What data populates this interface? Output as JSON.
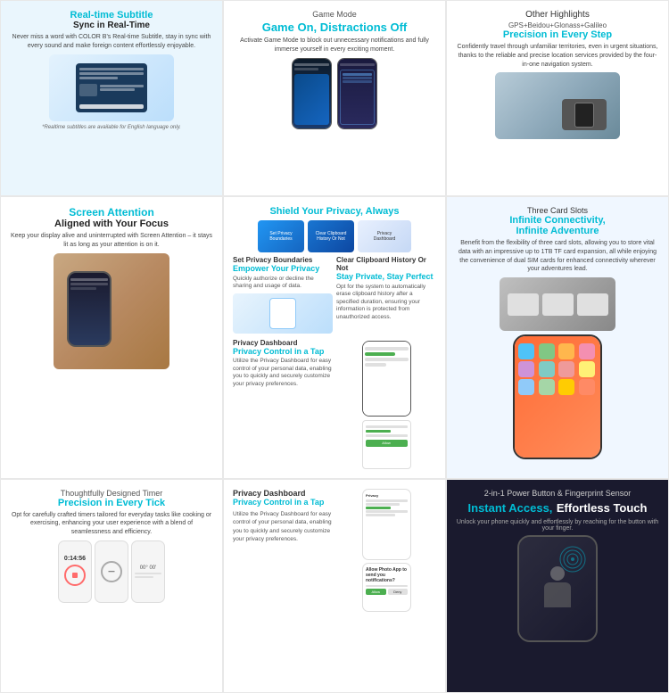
{
  "sections": {
    "cell1": {
      "label": "Real-time Subtitle",
      "subtitle": "Sync in Real-Time",
      "body": "Never miss a word with COLOR B's Real-time Subtitle, stay in sync with every sound and make foreign content effortlessly enjoyable.",
      "note": "*Realtime subtitles are available for English language only."
    },
    "cell2": {
      "label": "Game Mode",
      "title": "Game On, Distractions Off",
      "body": "Activate Game Mode to block out unnecessary notifications and fully immerse yourself in every exciting moment."
    },
    "cell3": {
      "label": "Other Highlights",
      "gps_label": "GPS+Beidou+Glonass+Galileo",
      "title": "Precision in Every Step",
      "body": "Confidently travel through unfamiliar territories, even in urgent situations, thanks to the reliable and precise location services provided by the four-in-one navigation system."
    },
    "cell4": {
      "title": "Screen Attention",
      "subtitle": "Aligned with Your Focus",
      "body": "Keep your display alive and uninterrupted with Screen Attention – it stays lit as long as your attention is on it."
    },
    "cell5": {
      "title": "Shield Your Privacy, Always",
      "privacy1_title": "Set Privacy Boundaries",
      "privacy1_sub": "Empower Your Privacy",
      "privacy1_body": "Quickly authorize or decline the sharing and usage of data.",
      "privacy2_title": "Clear Clipboard History Or Not",
      "privacy2_sub": "Stay Private, Stay Perfect",
      "privacy2_body": "Opt for the system to automatically erase clipboard history after a specified duration, ensuring your information is protected from unauthorized access.",
      "privacy3_title": "Privacy Dashboard",
      "privacy3_sub": "Privacy Control in a Tap",
      "privacy3_body": "Utilize the Privacy Dashboard for easy control of your personal data, enabling you to quickly and securely customize your privacy preferences."
    },
    "cell6": {
      "label": "Three Card Slots",
      "title": "Infinite Connectivity, Infinite Adventure",
      "body": "Benefit from the flexibility of three card slots, allowing you to store vital data with an impressive up to 1TB TF card expansion, all while enjoying the convenience of dual SIM cards for enhanced connectivity wherever your adventures lead."
    },
    "cell7": {
      "label": "Thoughtfully Designed Timer",
      "title": "Precision in Every Tick",
      "body": "Opt for carefully crafted timers tailored for everyday tasks like cooking or exercising, enhancing your user experience with a blend of seamlessness and efficiency."
    },
    "cell8": {
      "privacy_dash_label": "Privacy Dashboard",
      "privacy_dash_sub": "Privacy Control in a Tap",
      "privacy_dash_body": "Utilize the Privacy Dashboard for easy control of your personal data, enabling you to quickly and securely customize your privacy preferences."
    },
    "cell9": {
      "label": "2-in-1 Power Button & Fingerprint Sensor",
      "title_part1": "Instant Access,",
      "title_part2": "Effortless Touch",
      "body": "Unlock your phone quickly and effortlessly by reaching for the button with your finger."
    }
  }
}
